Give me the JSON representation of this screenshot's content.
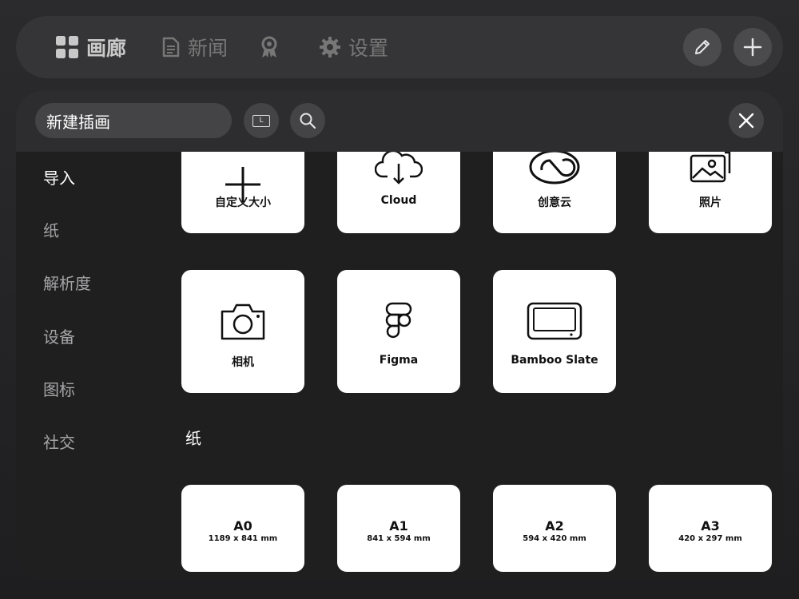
{
  "nav": {
    "items": [
      {
        "label": "画廊",
        "icon": "grid-icon",
        "active": true
      },
      {
        "label": "新闻",
        "icon": "document-icon",
        "active": false
      },
      {
        "label": "",
        "icon": "award-icon",
        "active": false
      },
      {
        "label": "设置",
        "icon": "gear-icon",
        "active": false
      }
    ],
    "actions": [
      {
        "icon": "pencil-icon"
      },
      {
        "icon": "plus-icon"
      }
    ]
  },
  "dialog": {
    "title": "新建插画",
    "orientation_badge": "L"
  },
  "sidebar": {
    "items": [
      {
        "label": "导入",
        "active": true
      },
      {
        "label": "纸",
        "active": false
      },
      {
        "label": "解析度",
        "active": false
      },
      {
        "label": "设备",
        "active": false
      },
      {
        "label": "图标",
        "active": false
      },
      {
        "label": "社交",
        "active": false
      }
    ]
  },
  "import_cards": [
    {
      "label": "自定义大小",
      "icon": "plus-icon"
    },
    {
      "label": "Cloud",
      "icon": "cloud-download-icon"
    },
    {
      "label": "创意云",
      "icon": "creative-cloud-icon"
    },
    {
      "label": "照片",
      "icon": "photos-icon"
    },
    {
      "label": "相机",
      "icon": "camera-icon"
    },
    {
      "label": "Figma",
      "icon": "figma-icon"
    },
    {
      "label": "Bamboo Slate",
      "icon": "tablet-icon"
    }
  ],
  "paper": {
    "title": "纸",
    "cards": [
      {
        "name": "A0",
        "size": "1189 x 841 mm"
      },
      {
        "name": "A1",
        "size": "841 x 594 mm"
      },
      {
        "name": "A2",
        "size": "594 x 420 mm"
      },
      {
        "name": "A3",
        "size": "420 x 297 mm"
      }
    ]
  },
  "colors": {
    "background": "#262628",
    "topbar": "#353537",
    "panel": "#1f1f20",
    "card": "#ffffff",
    "active_nav": "#c9c9c9",
    "inactive_nav": "#777777"
  }
}
